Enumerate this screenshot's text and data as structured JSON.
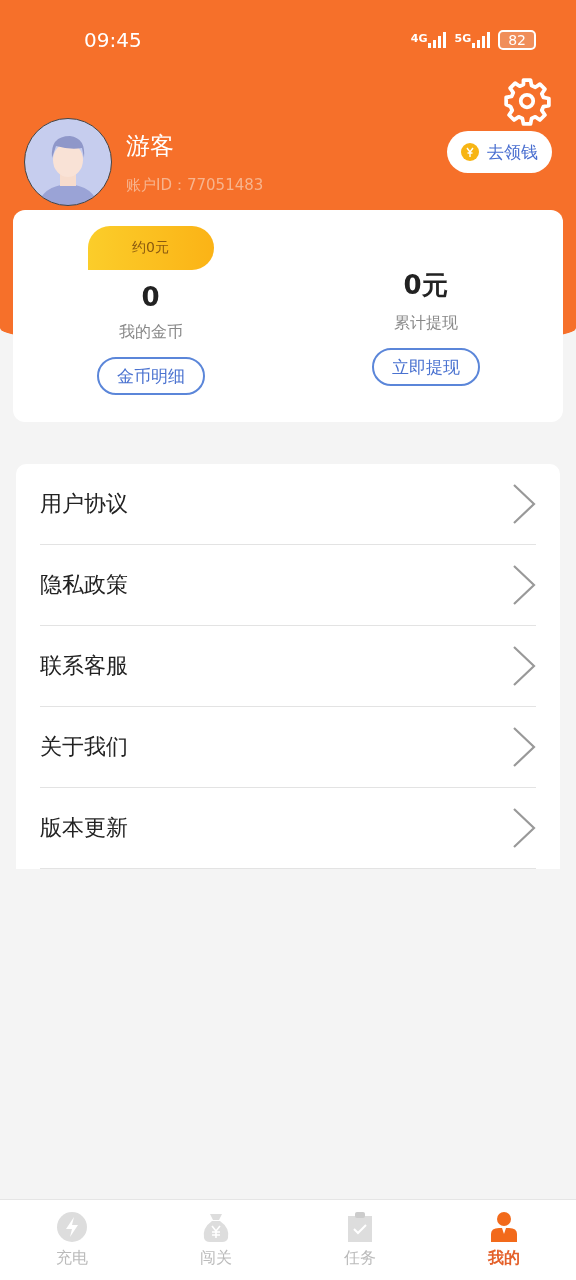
{
  "status_bar": {
    "time": "09:45",
    "networks": [
      "4G",
      "5G"
    ],
    "battery": "82"
  },
  "profile": {
    "name": "游客",
    "account_id": "账户ID：77051483",
    "earn_button": "去领钱"
  },
  "stats": [
    {
      "kind": "coins",
      "badge": "约0元",
      "value": "0",
      "label": "我的金币",
      "button": "金币明细"
    },
    {
      "kind": "withdraw",
      "value": "0元",
      "label": "累计提现",
      "button": "立即提现"
    }
  ],
  "menu": [
    {
      "label": "用户协议"
    },
    {
      "label": "隐私政策"
    },
    {
      "label": "联系客服"
    },
    {
      "label": "关于我们"
    },
    {
      "label": "版本更新"
    }
  ],
  "tabs": [
    {
      "label": "充电",
      "kind": "bolt",
      "selected": false
    },
    {
      "label": "闯关",
      "kind": "bag",
      "selected": false
    },
    {
      "label": "任务",
      "kind": "clipboard",
      "selected": false
    },
    {
      "label": "我的",
      "kind": "user",
      "selected": true
    }
  ]
}
